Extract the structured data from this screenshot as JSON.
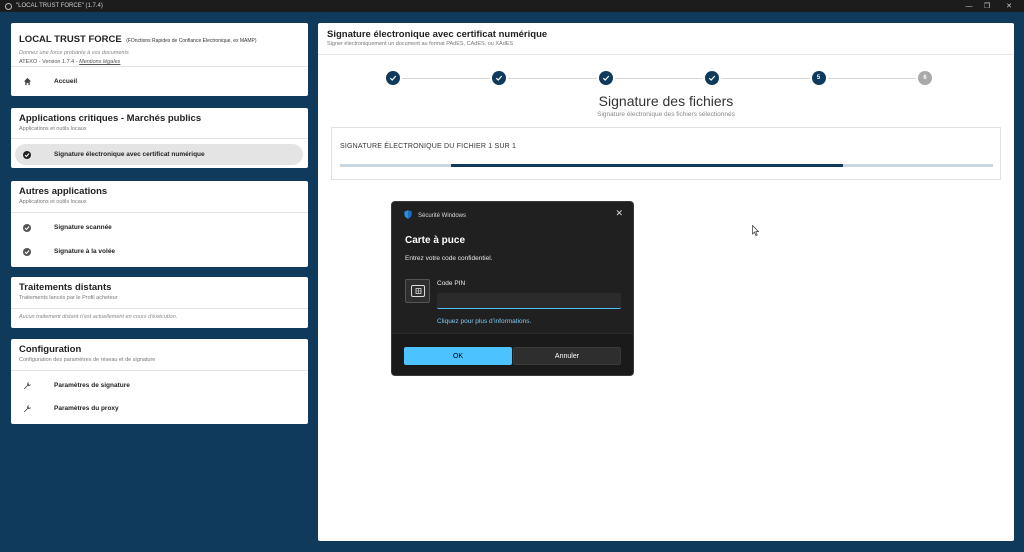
{
  "window": {
    "title": "\"LOCAL TRUST FORCE\" (1.7.4)",
    "controls": {
      "minimize": "—",
      "maximize": "❐",
      "close": "✕"
    }
  },
  "app_card": {
    "title": "LOCAL TRUST FORCE",
    "title_note": "(FOnctions Rapides de Confiance Electronique, ex MAMP)",
    "tagline": "Donnez une force probante à vos documents",
    "version": "ATEXO - Version 1.7.4 -",
    "legal_link": "Mentions légales",
    "home_item": {
      "label": "Accueil",
      "icon": "home-icon"
    }
  },
  "critical_apps": {
    "title": "Applications critiques - Marchés publics",
    "subtitle": "Applications et outils locaux",
    "items": [
      {
        "label": "Signature électronique avec certificat numérique",
        "icon": "check-circle-icon",
        "active": true
      }
    ]
  },
  "other_apps": {
    "title": "Autres applications",
    "subtitle": "Applications et outils locaux",
    "items": [
      {
        "label": "Signature scannée",
        "icon": "check-circle-icon"
      },
      {
        "label": "Signature à la volée",
        "icon": "check-circle-icon"
      }
    ]
  },
  "remote_processing": {
    "title": "Traitements distants",
    "subtitle": "Traitements lancés par le Profil acheteur",
    "empty_message": "Aucun traitement distant n'est actuellement en cours d'exécution."
  },
  "configuration": {
    "title": "Configuration",
    "subtitle": "Configuration des paramètres de réseau et de signature",
    "items": [
      {
        "label": "Paramètres de signature",
        "icon": "wrench-icon"
      },
      {
        "label": "Paramètres du proxy",
        "icon": "wrench-icon"
      }
    ]
  },
  "main": {
    "title": "Signature électronique avec certificat numérique",
    "subtitle": "Signer électroniquement un document au format PAdES, CAdES, ou XAdES",
    "steps": [
      {
        "label": "",
        "state": "done"
      },
      {
        "label": "",
        "state": "done"
      },
      {
        "label": "",
        "state": "done"
      },
      {
        "label": "",
        "state": "done"
      },
      {
        "label": "5",
        "state": "current"
      },
      {
        "label": "6",
        "state": "pending"
      }
    ],
    "step_title": "Signature des fichiers",
    "step_subtitle": "Signature électronique des fichiers sélectionnés",
    "file_progress_label": "SIGNATURE ÉLECTRONIQUE DU FICHIER 1 SUR 1",
    "progress_segment": {
      "start": 0.17,
      "end": 0.77
    }
  },
  "dialog": {
    "header": "Sécurité Windows",
    "title": "Carte à puce",
    "message": "Entrez votre code confidentiel.",
    "pin_label": "Code PIN",
    "pin_value": "",
    "more_info": "Cliquez pour plus d’informations.",
    "ok_label": "OK",
    "cancel_label": "Annuler",
    "accent_color": "#4cc2ff"
  },
  "colors": {
    "background": "#0f3a5c",
    "primary": "#0f3a5c",
    "pending": "#a9a9a9"
  }
}
